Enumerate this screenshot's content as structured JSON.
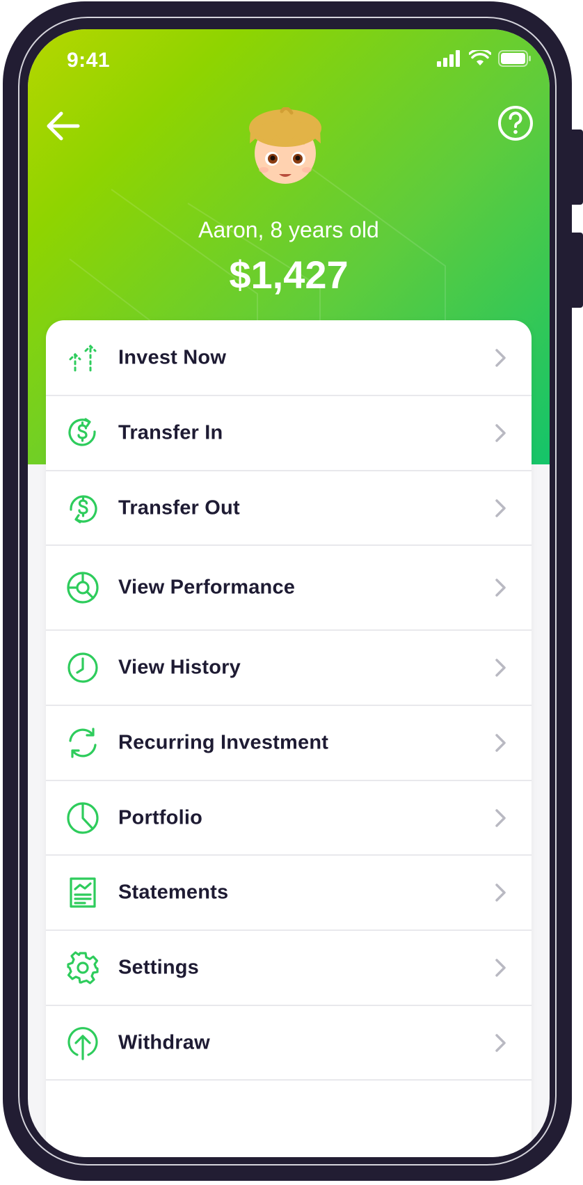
{
  "status_bar": {
    "time": "9:41"
  },
  "profile": {
    "name_age": "Aaron, 8 years old",
    "balance": "$1,427"
  },
  "colors": {
    "accent": "#2ecc5c",
    "text": "#1e1b33",
    "chevron": "#b9b9c2"
  },
  "menu": [
    {
      "label": "Invest Now",
      "icon": "invest-arrows-icon"
    },
    {
      "label": "Transfer In",
      "icon": "transfer-in-icon"
    },
    {
      "label": "Transfer Out",
      "icon": "transfer-out-icon"
    },
    {
      "label": "View Performance",
      "icon": "performance-icon"
    },
    {
      "label": "View History",
      "icon": "clock-icon"
    },
    {
      "label": "Recurring Investment",
      "icon": "recurring-icon"
    },
    {
      "label": "Portfolio",
      "icon": "pie-chart-icon"
    },
    {
      "label": "Statements",
      "icon": "statement-icon"
    },
    {
      "label": "Settings",
      "icon": "gear-icon"
    },
    {
      "label": "Withdraw",
      "icon": "upload-circle-icon"
    }
  ]
}
